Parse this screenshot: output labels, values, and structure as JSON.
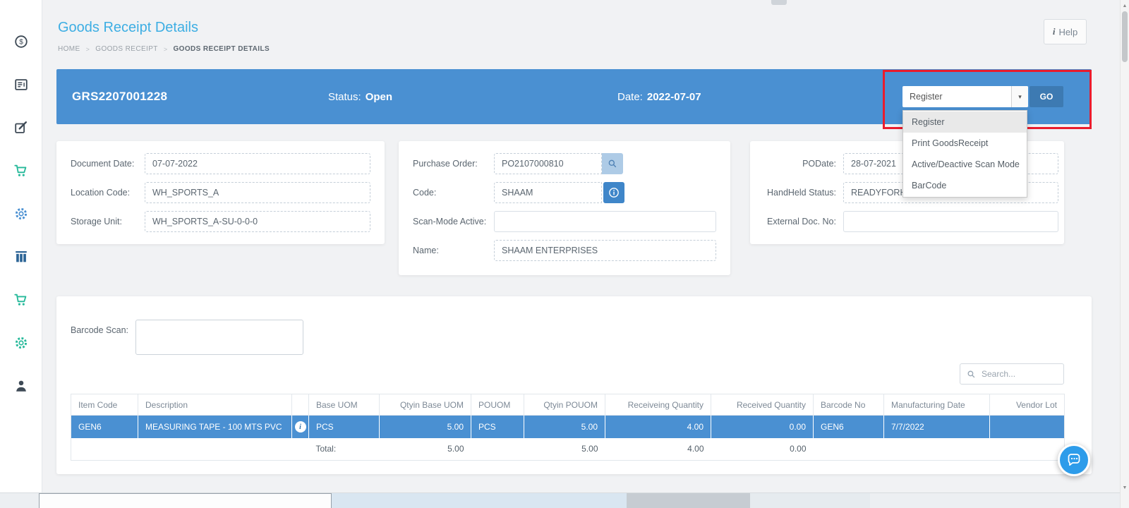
{
  "page": {
    "title": "Goods Receipt Details",
    "help": {
      "icon": "i",
      "label": "Help"
    }
  },
  "breadcrumb": {
    "separator": ">",
    "items": [
      "HOME",
      "GOODS RECEIPT",
      "GOODS RECEIPT DETAILS"
    ]
  },
  "header_bar": {
    "doc_number": "GRS2207001228",
    "status_label": "Status:",
    "status_value": "Open",
    "date_label": "Date:",
    "date_value": "2022-07-07",
    "action_selected": "Register",
    "go_label": "GO",
    "menu_items": [
      "Register",
      "Print GoodsReceipt",
      "Active/Deactive Scan Mode",
      "BarCode"
    ]
  },
  "cards": {
    "document": {
      "fields": [
        {
          "label": "Document Date:",
          "value": "07-07-2022"
        },
        {
          "label": "Location Code:",
          "value": "WH_SPORTS_A"
        },
        {
          "label": "Storage Unit:",
          "value": "WH_SPORTS_A-SU-0-0-0"
        }
      ]
    },
    "purchase": {
      "fields": [
        {
          "label": "Purchase Order:",
          "value": "PO2107000810"
        },
        {
          "label": "Code:",
          "value": "SHAAM"
        },
        {
          "label": "Scan-Mode Active:",
          "value": ""
        },
        {
          "label": "Name:",
          "value": "SHAAM ENTERPRISES"
        }
      ]
    },
    "po_info": {
      "fields": [
        {
          "label": "PODate:",
          "value": "28-07-2021"
        },
        {
          "label": "HandHeld Status:",
          "value": "READYFORHANDHELD"
        },
        {
          "label": "External Doc. No:",
          "value": ""
        }
      ]
    }
  },
  "lower": {
    "barcode_label": "Barcode Scan:",
    "barcode_value": "",
    "search_placeholder": "Search..."
  },
  "table": {
    "headers": [
      "Item Code",
      "Description",
      "",
      "Base UOM",
      "Qtyin Base UOM",
      "POUOM",
      "Qtyin POUOM",
      "Receiveing Quantity",
      "Received Quantity",
      "Barcode No",
      "Manufacturing Date",
      "Vendor Lot"
    ],
    "row": {
      "cells": [
        "GEN6",
        "MEASURING TAPE - 100 MTS PVC",
        "",
        "PCS",
        "5.00",
        "PCS",
        "5.00",
        "4.00",
        "0.00",
        "GEN6",
        "7/7/2022",
        ""
      ]
    },
    "total": {
      "label": "Total:",
      "qty_base_uom": "5.00",
      "qty_pouom": "5.00",
      "receiving_qty": "4.00",
      "received_qty": "0.00"
    }
  },
  "sidebar": {
    "icons": [
      "finance-icon",
      "documents-icon",
      "edit-icon",
      "cart-icon",
      "settings-icon",
      "columns-icon",
      "cart-icon",
      "settings-icon",
      "user-location-icon"
    ]
  },
  "glyphs": {
    "caret_down": "▾",
    "scroll_up": "▲",
    "scroll_down": "▼",
    "row_info": "i"
  },
  "colors": {
    "primary_blue": "#4a90d2",
    "title_blue": "#3daee3",
    "annotation_red": "#ea1c2d",
    "selected_row_blue": "#4a90d2",
    "teal_icon": "#26b99a",
    "dark_icon": "#3e4a56"
  }
}
